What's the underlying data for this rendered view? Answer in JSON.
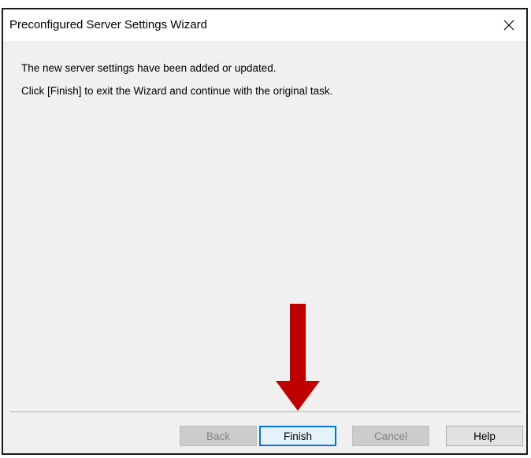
{
  "window": {
    "title": "Preconfigured Server Settings Wizard",
    "close_icon": "close-icon"
  },
  "content": {
    "message_line1": "The new server settings have been added or updated.",
    "message_line2": "Click [Finish] to exit the Wizard and continue with the original task."
  },
  "buttons": {
    "back": {
      "label": "Back",
      "enabled": false
    },
    "finish": {
      "label": "Finish",
      "enabled": true,
      "default": true
    },
    "cancel": {
      "label": "Cancel",
      "enabled": false
    },
    "help": {
      "label": "Help",
      "enabled": true
    }
  },
  "annotation": {
    "arrow_icon": "arrow-down-icon",
    "arrow_color": "#c00000"
  },
  "colors": {
    "dialog_background": "#f0f0f0",
    "focus_border": "#0078d7"
  }
}
